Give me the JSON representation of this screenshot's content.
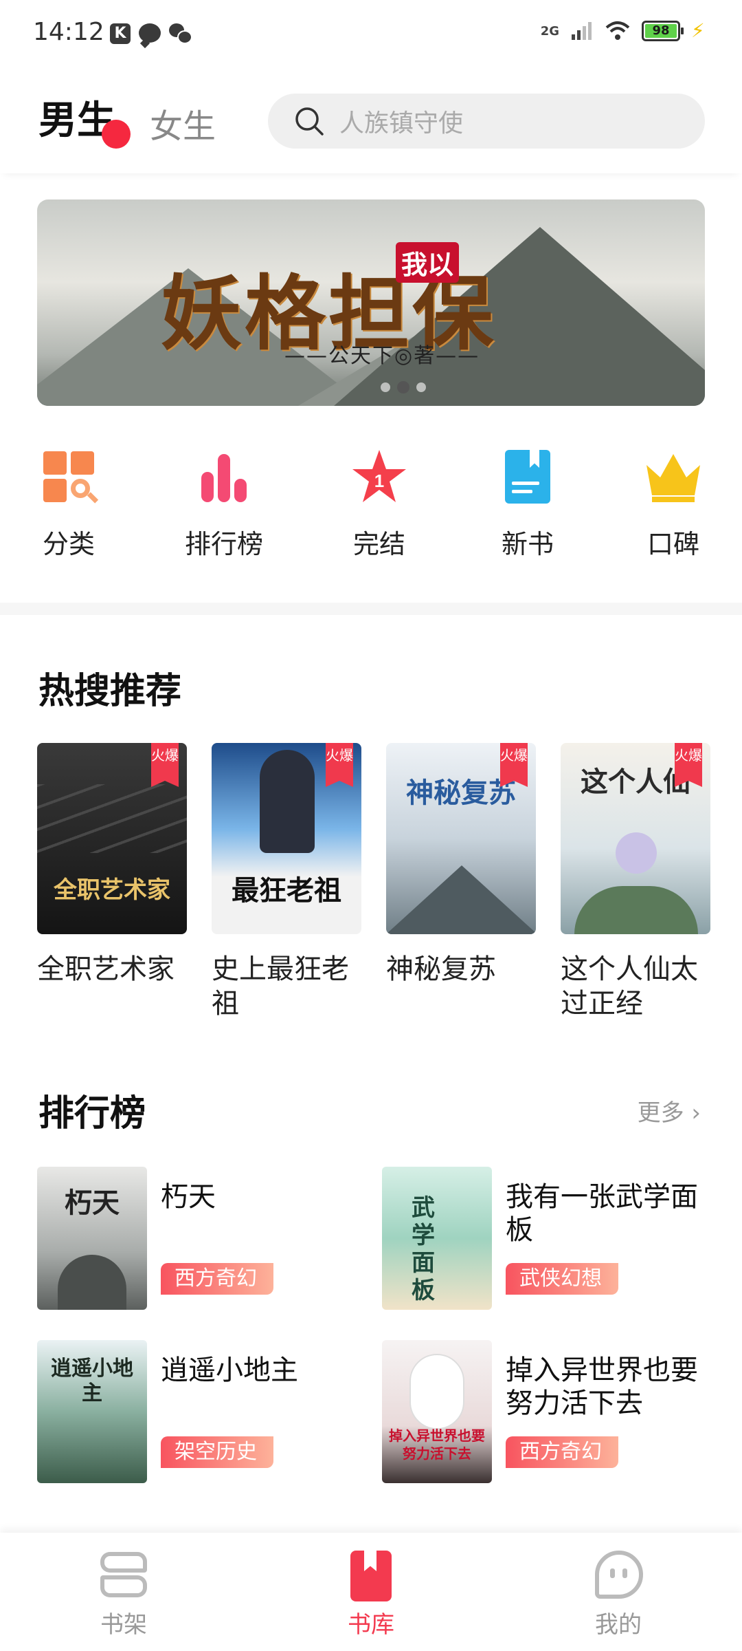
{
  "status_bar": {
    "time": "14:12",
    "network": "2G",
    "battery": "98",
    "icons": [
      "k-app-icon",
      "message-icon",
      "wechat-icon",
      "signal-icon",
      "wifi-icon",
      "battery-icon",
      "charging-icon"
    ]
  },
  "header": {
    "tab_male": "男生",
    "tab_female": "女生",
    "search_placeholder": "人族镇守使"
  },
  "banner": {
    "tag": "我以",
    "title": "妖格担保",
    "author": "——公天下◎著——"
  },
  "categories": [
    {
      "label": "分类",
      "icon": "grid-search-icon",
      "color": "#f7874e"
    },
    {
      "label": "排行榜",
      "icon": "bar-chart-icon",
      "color": "#f44a73"
    },
    {
      "label": "完结",
      "icon": "star-badge-icon",
      "color": "#f43f4b"
    },
    {
      "label": "新书",
      "icon": "book-icon",
      "color": "#2bb2ea"
    },
    {
      "label": "口碑",
      "icon": "crown-icon",
      "color": "#f7c41a"
    }
  ],
  "hot_search": {
    "title": "热搜推荐",
    "badge": "火爆",
    "books": [
      {
        "name": "全职艺术家",
        "cover_text": "全职艺术家"
      },
      {
        "name": "史上最狂老祖",
        "cover_text": "最狂老祖"
      },
      {
        "name": "神秘复苏",
        "cover_text": "神秘复苏"
      },
      {
        "name": "这个人仙太过正经",
        "cover_text": "这个人仙"
      }
    ]
  },
  "ranking": {
    "title": "排行榜",
    "more": "更多",
    "books": [
      {
        "title": "朽天",
        "tag": "西方奇幻",
        "cover_text": "朽天"
      },
      {
        "title": "我有一张武学面板",
        "tag": "武侠幻想",
        "cover_text": "武学面板"
      },
      {
        "title": "逍遥小地主",
        "tag": "架空历史",
        "cover_text": "逍遥小地主"
      },
      {
        "title": "掉入异世界也要努力活下去",
        "tag": "西方奇幻",
        "cover_text": "掉入异世界也要努力活下去"
      }
    ]
  },
  "bottom_nav": {
    "items": [
      {
        "label": "书架",
        "active": false
      },
      {
        "label": "书库",
        "active": true
      },
      {
        "label": "我的",
        "active": false
      }
    ],
    "accent": "#f33a4f"
  }
}
